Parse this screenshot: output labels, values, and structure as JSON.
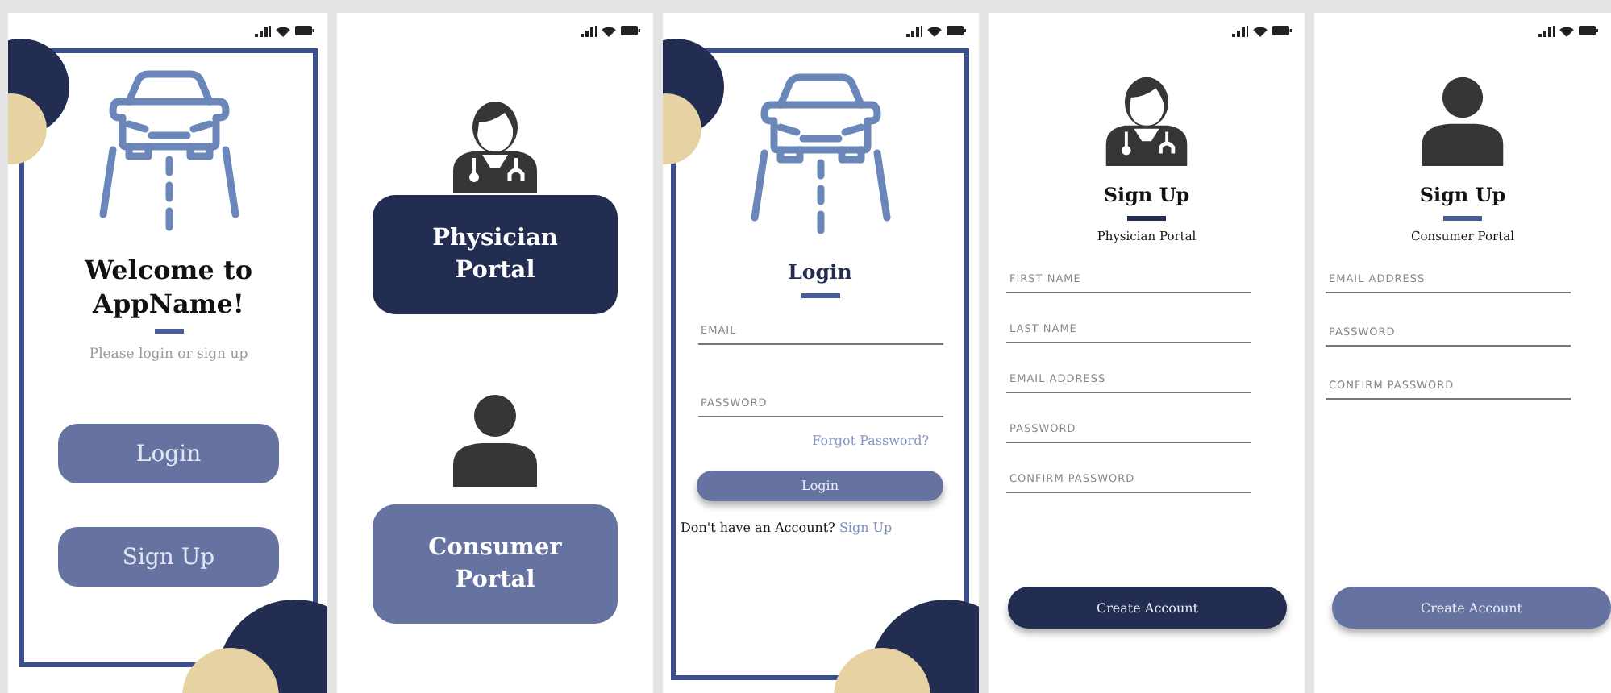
{
  "screens": [
    {
      "kind": "welcome",
      "title": "Welcome to AppName!",
      "subtitle": "Please login or sign up",
      "buttons": [
        {
          "label": "Login",
          "color": "#6673a1"
        },
        {
          "label": "Sign Up",
          "color": "#6673a1"
        }
      ]
    },
    {
      "kind": "portal",
      "options": [
        {
          "kind": "physician",
          "label": "Physician Portal",
          "color": "#232d52"
        },
        {
          "kind": "consumer",
          "label": "Consumer Portal",
          "color": "#6673a1"
        }
      ]
    },
    {
      "kind": "login",
      "title": "Login",
      "fields": [
        {
          "placeholder": "EMAIL"
        },
        {
          "placeholder": "PASSWORD"
        }
      ],
      "link": "Forgot Password?",
      "button": {
        "label": "Login",
        "color": "#6673a1"
      },
      "prompt": "Don't have an Account?",
      "prompt_link": "Sign Up"
    },
    {
      "kind": "physician_signup",
      "title": "Sign Up",
      "subtitle": "Physician Portal",
      "fields": [
        {
          "placeholder": "FIRST NAME"
        },
        {
          "placeholder": "LAST NAME"
        },
        {
          "placeholder": "EMAIL ADDRESS"
        },
        {
          "placeholder": "PASSWORD"
        },
        {
          "placeholder": "CONFIRM PASSWORD"
        }
      ],
      "button": {
        "label": "Create Account",
        "color": "#232d52"
      }
    },
    {
      "kind": "consumer_signup",
      "title": "Sign Up",
      "subtitle": "Consumer Portal",
      "fields": [
        {
          "placeholder": "EMAIL ADDRESS"
        },
        {
          "placeholder": "PASSWORD"
        },
        {
          "placeholder": "CONFIRM PASSWORD"
        }
      ],
      "button": {
        "label": "Create Account",
        "color": "#6673a1"
      }
    }
  ]
}
